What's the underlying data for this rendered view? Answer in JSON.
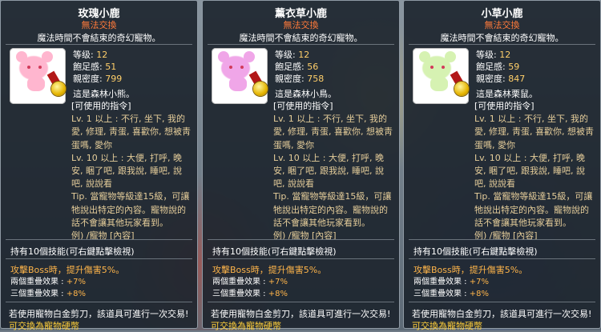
{
  "cards": [
    {
      "title": "玫瑰小鹿",
      "trade": "無法交換",
      "desc": "魔法時間不會結束的奇幻寵物。",
      "pet_color": "#ffb6cf",
      "level_label": "等级:",
      "level": "12",
      "hunger_label": "飽足感:",
      "hunger": "51",
      "affinity_label": "親密度:",
      "affinity": "799",
      "forest": "這是森林小熊。",
      "cmd_head": "[可使用的指令]",
      "cmd1": "Lv. 1 以上 : 不行, 坐下, 我的愛, 修理, 靑蛋, 喜歡你, 想被靑蛋嗎, 愛你",
      "cmd2": "Lv. 10 以上 : 大便, 打呼, 晚安, 睏了吧, 跟我說, 睡吧, 說吧, 說說看",
      "tip": "Tip. 當寵物等級達15級，可讓牠說出特定的內容。寵物說的話不會讓其他玩家看到。",
      "example": "例) /寵物 [內容]",
      "skill": "持有10個技能(可右鍵點擊檢視)",
      "eff1": "攻擊Boss時，提升傷害5%。",
      "eff2_label": "兩個重疊效果 :",
      "eff2": "+7%",
      "eff3_label": "三個重疊效果 :",
      "eff3": "+8%",
      "foot1": "若使用寵物白金剪刀，該道具可進行一次交易!",
      "foot2": "可交換為寵物硬幣"
    },
    {
      "title": "薰衣草小鹿",
      "trade": "無法交換",
      "desc": "魔法時間不會結束的奇幻寵物。",
      "pet_color": "#f0a6e8",
      "level_label": "等级:",
      "level": "12",
      "hunger_label": "飽足感:",
      "hunger": "56",
      "affinity_label": "親密度:",
      "affinity": "758",
      "forest": "這是森林小鳥。",
      "cmd_head": "[可使用的指令]",
      "cmd1": "Lv. 1 以上 : 不行, 坐下, 我的愛, 修理, 靑蛋, 喜歡你, 想被靑蛋嗎, 愛你",
      "cmd2": "Lv. 10 以上 : 大便, 打呼, 晚安, 睏了吧, 跟我說, 睡吧, 說吧, 說說看",
      "tip": "Tip. 當寵物等級達15級，可讓牠說出特定的內容。寵物說的話不會讓其他玩家看到。",
      "example": "例) /寵物 [內容]",
      "skill": "持有10個技能(可右鍵點擊檢視)",
      "eff1": "攻擊Boss時，提升傷害5%。",
      "eff2_label": "兩個重疊效果 :",
      "eff2": "+7%",
      "eff3_label": "三個重疊效果 :",
      "eff3": "+8%",
      "foot1": "若使用寵物白金剪刀，該道具可進行一次交易!",
      "foot2": "可交換為寵物硬幣"
    },
    {
      "title": "小草小鹿",
      "trade": "無法交換",
      "desc": "魔法時間不會結束的奇幻寵物。",
      "pet_color": "#d6f2b2",
      "level_label": "等级:",
      "level": "12",
      "hunger_label": "飽足感:",
      "hunger": "59",
      "affinity_label": "親密度:",
      "affinity": "847",
      "forest": "這是森林栗鼠。",
      "cmd_head": "[可使用的指令]",
      "cmd1": "Lv. 1 以上 : 不行, 坐下, 我的愛, 修理, 靑蛋, 喜歡你, 想被靑蛋嗎, 愛你",
      "cmd2": "Lv. 10 以上 : 大便, 打呼, 晚安, 睏了吧, 跟我說, 睡吧, 說吧, 說說看",
      "tip": "Tip. 當寵物等級達15級，可讓牠說出特定的內容。寵物說的話不會讓其他玩家看到。",
      "example": "例) /寵物 [內容]",
      "skill": "持有10個技能(可右鍵點擊檢視)",
      "eff1": "攻擊Boss時，提升傷害5%。",
      "eff2_label": "兩個重疊效果 :",
      "eff2": "+7%",
      "eff3_label": "三個重疊效果 :",
      "eff3": "+8%",
      "foot1": "若使用寵物白金剪刀，該道具可進行一次交易!",
      "foot2": "可交換為寵物硬幣"
    }
  ]
}
